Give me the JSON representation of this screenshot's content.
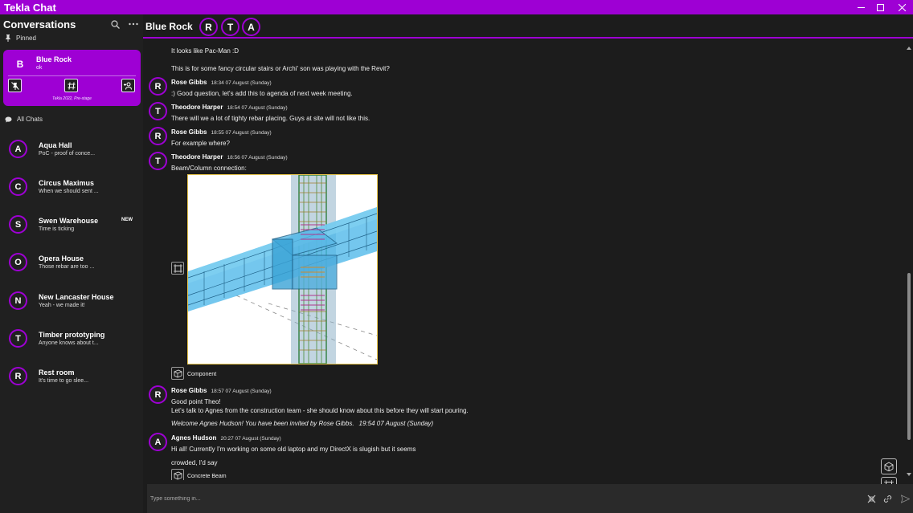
{
  "app": {
    "title": "Tekla Chat"
  },
  "sidebar": {
    "title": "Conversations",
    "pinned_label": "Pinned",
    "pinned": {
      "avatar": "B",
      "name": "Blue Rock",
      "preview": "ok",
      "footer": "Tekla 2022, Pre-stage"
    },
    "all_chats_label": "All Chats",
    "chats": [
      {
        "avatar": "A",
        "name": "Aqua Hall",
        "preview": "PoC - proof of conce...",
        "badge": ""
      },
      {
        "avatar": "C",
        "name": "Circus Maximus",
        "preview": "When we should sent ...",
        "badge": ""
      },
      {
        "avatar": "S",
        "name": "Swen Warehouse",
        "preview": "Time is ticking",
        "badge": "NEW"
      },
      {
        "avatar": "O",
        "name": "Opera House",
        "preview": "Those rebar are too ...",
        "badge": ""
      },
      {
        "avatar": "N",
        "name": "New Lancaster House",
        "preview": "Yeah - we made it!",
        "badge": ""
      },
      {
        "avatar": "T",
        "name": "Timber prototyping",
        "preview": "Anyone knows about t...",
        "badge": ""
      },
      {
        "avatar": "R",
        "name": "Rest room",
        "preview": "It's time to go slee...",
        "badge": ""
      }
    ]
  },
  "header": {
    "title": "Blue Rock",
    "members": [
      "R",
      "T",
      "A"
    ]
  },
  "messages": {
    "lines": [
      "It looks like Pac-Man :D",
      "This is for some fancy circular stairs or Archi' son was playing with the Revit?"
    ],
    "m1": {
      "avatar": "R",
      "author": "Rose Gibbs",
      "time": "18:34 07 August (Sunday)",
      "text": ":) Good question, let's add this to agenda of next week meeting."
    },
    "m2": {
      "avatar": "T",
      "author": "Theodore Harper",
      "time": "18:54 07 August (Sunday)",
      "text": "There will we a lot of tighty rebar placing. Guys at site will not like this."
    },
    "m3": {
      "avatar": "R",
      "author": "Rose Gibbs",
      "time": "18:55 07 August (Sunday)",
      "text": "For example where?"
    },
    "m4": {
      "avatar": "T",
      "author": "Theodore Harper",
      "time": "18:56 07 August (Sunday)",
      "text": "Beam/Column connection:",
      "attachment": "Component"
    },
    "m5": {
      "avatar": "R",
      "author": "Rose Gibbs",
      "time": "18:57 07 August (Sunday)",
      "text1": "Good point Theo!",
      "text2": "Let's talk to Agnes from the construction team - she should know about this before they will start pouring."
    },
    "system": {
      "text": "Welcome Agnes Hudson! You have been invited by Rose Gibbs.",
      "time": "19:54 07 August (Sunday)"
    },
    "m6": {
      "avatar": "A",
      "author": "Agnes Hudson",
      "time": "20:27 07 August (Sunday)",
      "text1": "Hi all! Currently I'm working on some old laptop and my DirectX is slugish but it seems",
      "text2": "crowded, I'd say",
      "attachment": "Concrete Beam"
    }
  },
  "composer": {
    "placeholder": "Type something in..."
  },
  "colors": {
    "accent": "#9e00d4",
    "background": "#1c1c1c",
    "sidebar": "#202020"
  }
}
